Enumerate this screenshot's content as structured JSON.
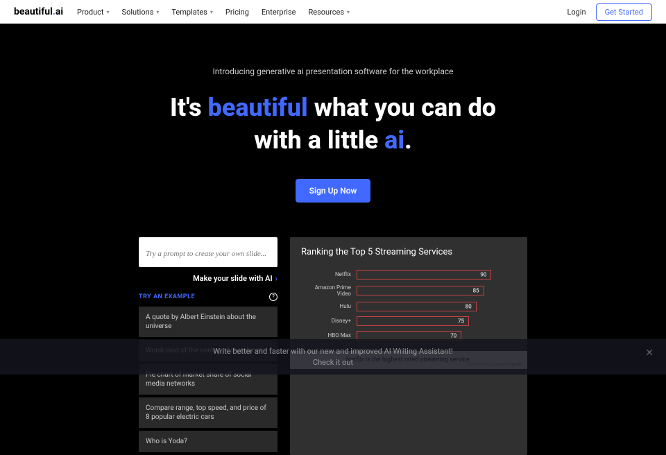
{
  "nav": {
    "logo_prefix": "beautiful",
    "logo_suffix": "ai",
    "items": [
      "Product",
      "Solutions",
      "Templates",
      "Pricing",
      "Enterprise",
      "Resources"
    ],
    "login": "Login",
    "get_started": "Get Started"
  },
  "hero": {
    "subtitle": "Introducing generative ai presentation software for the workplace",
    "h1_part1": "It's ",
    "h1_blue1": "beautiful",
    "h1_part2": " what you can do",
    "h1_part3": "with a little ",
    "h1_blue2": "ai",
    "h1_part4": ".",
    "cta": "Sign Up Now"
  },
  "prompt": {
    "placeholder": "Try a prompt to create your own slide...",
    "make_slide": "Make your slide with AI",
    "try_label": "TRY AN EXAMPLE",
    "examples": [
      "A quote by Albert Einstein about the universe",
      "Wordcloud of the names of the planets",
      "Pie chart of market share of social media networks",
      "Compare range, top speed, and price of 8 popular electric cars",
      "Who is Yoda?"
    ]
  },
  "chart_data": {
    "type": "bar",
    "title": "Ranking the Top 5 Streaming Services",
    "categories": [
      "Netflix",
      "Amazon Prime Video",
      "Hulu",
      "Disney+",
      "HBO Max"
    ],
    "values": [
      90,
      85,
      80,
      75,
      70
    ],
    "xlim": [
      0,
      100
    ],
    "footer": "Netflix is the highest rated streaming service.",
    "note": "Data from Consumer Reports"
  },
  "banner": {
    "line1": "Write better and faster with our new and improved AI Writing Assistant!",
    "line2": "Check it out"
  }
}
